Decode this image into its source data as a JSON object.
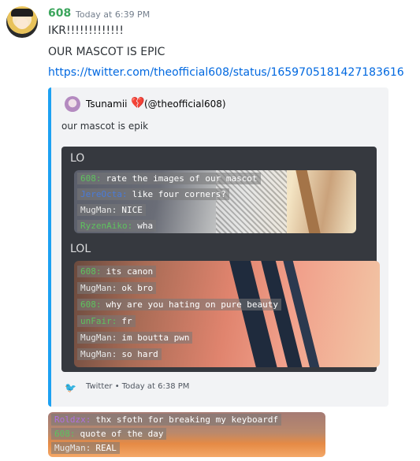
{
  "message": {
    "username": "608",
    "timestamp": "Today at 6:39 PM",
    "lines": [
      "IKR!!!!!!!!!!!!!",
      "OUR MASCOT IS EPIC"
    ],
    "link": "https://twitter.com/theofficial608/status/1659705181427183616"
  },
  "embed": {
    "author_name": "Tsunamii",
    "author_emoji": "💔",
    "author_handle": "(@theofficial608)",
    "description": "our mascot is epik",
    "media_header_1": "LO",
    "media_header_2": "LOL",
    "footer": "Twitter • Today at 6:38 PM",
    "accent_color": "#1da1f2"
  },
  "image1_chat": [
    {
      "name": "608:",
      "text": "rate the images of our mascot",
      "color": "#5ec25e"
    },
    {
      "name": "JereOcta:",
      "text": "like four corners?",
      "color": "#4a7bd9"
    },
    {
      "name": "MugMan:",
      "text": "NICE",
      "color": "#e6e6e6"
    },
    {
      "name": "RyzenAiko:",
      "text": "wha",
      "color": "#5ec25e"
    }
  ],
  "image2_chat": [
    {
      "name": "608:",
      "text": "its canon",
      "color": "#5ec25e"
    },
    {
      "name": "MugMan:",
      "text": "ok bro",
      "color": "#e6e6e6"
    },
    {
      "name": "608:",
      "text": "why are you hating on pure beauty",
      "color": "#5ec25e"
    },
    {
      "name": "unFair:",
      "text": "fr",
      "color": "#5ec25e"
    },
    {
      "name": "MugMan:",
      "text": "im boutta pwn",
      "color": "#e6e6e6"
    },
    {
      "name": "MugMan:",
      "text": "so hard",
      "color": "#e6e6e6"
    }
  ],
  "image3_chat": [
    {
      "name": "Roldzx:",
      "text": "thx sfoth for breaking my keyboardf",
      "color": "#b070e0"
    },
    {
      "name": "608:",
      "text": "quote of the day",
      "color": "#5ec25e"
    },
    {
      "name": "MugMan:",
      "text": "REAL",
      "color": "#e6e6e6"
    }
  ]
}
